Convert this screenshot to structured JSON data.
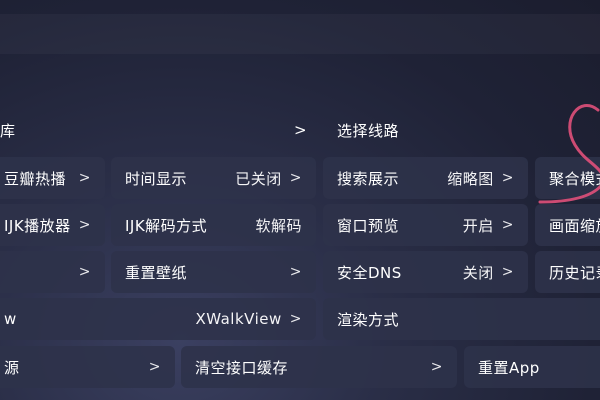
{
  "rows": {
    "row1": {
      "library_label": "库",
      "library_chevron": ">",
      "route_label": "选择线路"
    },
    "row2": [
      {
        "label": "豆瓣热播",
        "value": "",
        "chevron": ">"
      },
      {
        "label": "时间显示",
        "value": "已关闭",
        "chevron": ">"
      },
      {
        "label": "搜索展示",
        "value": "缩略图",
        "chevron": ">"
      },
      {
        "label": "聚合模式",
        "value": "",
        "chevron": ""
      }
    ],
    "row3": [
      {
        "label": "IJK播放器",
        "value": "",
        "chevron": ">"
      },
      {
        "label": "IJK解码方式",
        "value": "软解码",
        "chevron": ""
      },
      {
        "label": "窗口预览",
        "value": "开启",
        "chevron": ">"
      },
      {
        "label": "画面缩放",
        "value": "",
        "chevron": ""
      }
    ],
    "row4": [
      {
        "label": "",
        "value": "",
        "chevron": ">"
      },
      {
        "label": "重置壁纸",
        "value": "",
        "chevron": ">"
      },
      {
        "label": "安全DNS",
        "value": "关闭",
        "chevron": ">"
      },
      {
        "label": "历史记录",
        "value": "",
        "chevron": ""
      }
    ],
    "row5": [
      {
        "label": "w",
        "value": "XWalkView",
        "chevron": ">"
      },
      {
        "label": "渲染方式",
        "value": "",
        "chevron": ""
      }
    ],
    "row6": [
      {
        "label": "源",
        "value": "",
        "chevron": ">"
      },
      {
        "label": "清空接口缓存",
        "value": "",
        "chevron": ">"
      },
      {
        "label": "重置App",
        "value": "",
        "chevron": ""
      }
    ]
  },
  "colors": {
    "background": "#22253a",
    "tile": "#2e324a",
    "accent_swirl": "#e0507a"
  },
  "icons": [
    "chevron-right-icon",
    "decorative-swirl-icon"
  ]
}
